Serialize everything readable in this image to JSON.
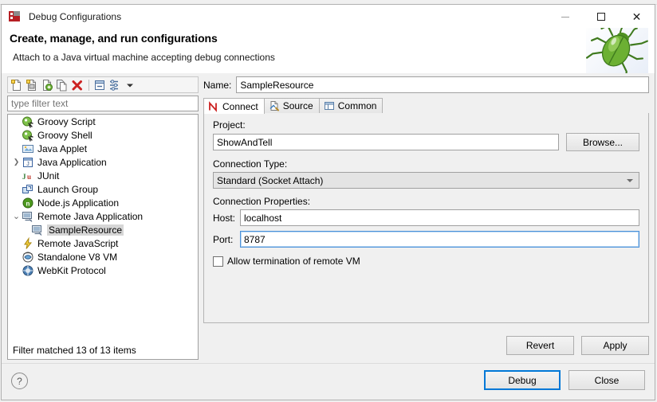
{
  "window": {
    "title": "Debug Configurations",
    "title_icon": "debug-configurations-icon",
    "minimize_label": "Minimize",
    "maximize_label": "Maximize",
    "close_label": "Close"
  },
  "banner": {
    "heading": "Create, manage, and run configurations",
    "subtext": "Attach to a Java virtual machine accepting debug connections",
    "decoration_icon": "green-bug-icon"
  },
  "tree_toolbar": {
    "buttons": [
      {
        "name": "new-configuration-icon",
        "tooltip": "New launch configuration"
      },
      {
        "name": "new-prototype-icon",
        "tooltip": "New prototype"
      },
      {
        "name": "export-configuration-icon",
        "tooltip": "Export"
      },
      {
        "name": "duplicate-configuration-icon",
        "tooltip": "Duplicate"
      },
      {
        "name": "delete-configuration-icon",
        "tooltip": "Delete"
      },
      {
        "name": "collapse-all-icon",
        "tooltip": "Collapse All"
      },
      {
        "name": "filter-launch-configurations-icon",
        "tooltip": "Filter"
      },
      {
        "name": "view-menu-chevron-icon",
        "tooltip": "View Menu"
      }
    ]
  },
  "filter": {
    "placeholder": "type filter text",
    "value": ""
  },
  "tree": {
    "items": [
      {
        "label": "Groovy Script",
        "icon": "groovy-script-icon",
        "level": 1,
        "expander": "",
        "selected": false
      },
      {
        "label": "Groovy Shell",
        "icon": "groovy-shell-icon",
        "level": 1,
        "expander": "",
        "selected": false
      },
      {
        "label": "Java Applet",
        "icon": "java-applet-icon",
        "level": 1,
        "expander": "",
        "selected": false
      },
      {
        "label": "Java Application",
        "icon": "java-application-icon",
        "level": 1,
        "expander": "▸",
        "selected": false
      },
      {
        "label": "JUnit",
        "icon": "junit-icon",
        "level": 1,
        "expander": "",
        "selected": false
      },
      {
        "label": "Launch Group",
        "icon": "launch-group-icon",
        "level": 1,
        "expander": "",
        "selected": false
      },
      {
        "label": "Node.js Application",
        "icon": "nodejs-icon",
        "level": 1,
        "expander": "",
        "selected": false
      },
      {
        "label": "Remote Java Application",
        "icon": "remote-java-icon",
        "level": 1,
        "expander": "⌄",
        "selected": false
      },
      {
        "label": "SampleResource",
        "icon": "remote-java-icon",
        "level": 2,
        "expander": "",
        "selected": true
      },
      {
        "label": "Remote JavaScript",
        "icon": "remote-javascript-icon",
        "level": 1,
        "expander": "",
        "selected": false
      },
      {
        "label": "Standalone V8 VM",
        "icon": "v8-vm-icon",
        "level": 1,
        "expander": "",
        "selected": false
      },
      {
        "label": "WebKit Protocol",
        "icon": "webkit-icon",
        "level": 1,
        "expander": "",
        "selected": false
      }
    ],
    "status": "Filter matched 13 of 13 items"
  },
  "config": {
    "name_label": "Name:",
    "name_value": "SampleResource",
    "tabs": [
      {
        "label": "Connect",
        "icon": "connect-tab-icon",
        "active": true
      },
      {
        "label": "Source",
        "icon": "source-tab-icon",
        "active": false
      },
      {
        "label": "Common",
        "icon": "common-tab-icon",
        "active": false
      }
    ],
    "project": {
      "group_label": "Project:",
      "value": "ShowAndTell",
      "browse_label": "Browse..."
    },
    "connection_type": {
      "group_label": "Connection Type:",
      "selected": "Standard (Socket Attach)"
    },
    "connection_properties": {
      "group_label": "Connection Properties:",
      "host_label": "Host:",
      "host_value": "localhost",
      "port_label": "Port:",
      "port_value": "8787",
      "port_focused": true
    },
    "allow_termination": {
      "label": "Allow termination of remote VM",
      "checked": false
    },
    "revert_label": "Revert",
    "apply_label": "Apply"
  },
  "footer": {
    "help_label": "?",
    "debug_label": "Debug",
    "close_label": "Close"
  },
  "colors": {
    "accent": "#0078d7",
    "focus_border": "#4a90d9",
    "dialog_bg": "#f0f0f0",
    "delete_red": "#cc2222",
    "bug_green": "#5aa02c"
  }
}
